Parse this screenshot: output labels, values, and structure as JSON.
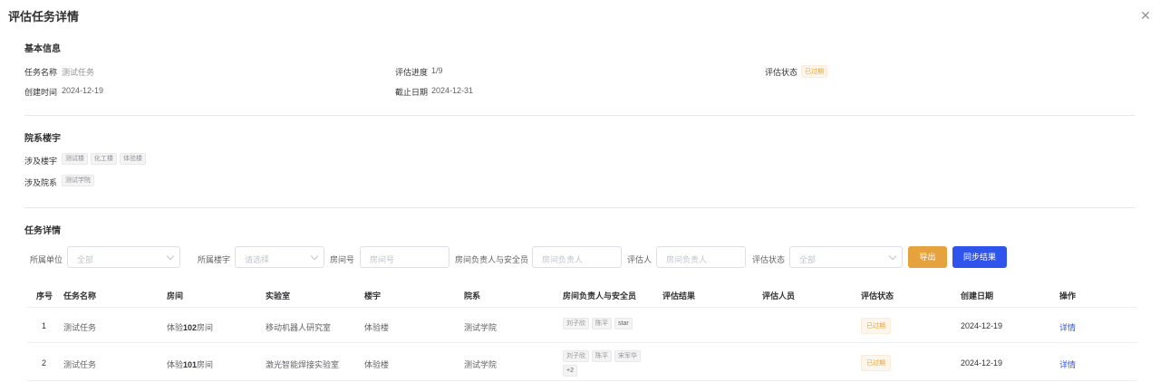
{
  "dialog": {
    "title": "评估任务详情"
  },
  "basic": {
    "section_title": "基本信息",
    "task_name_label": "任务名称",
    "task_name": "测试任务",
    "progress_label": "评估进度",
    "progress": "1/9",
    "status_label": "评估状态",
    "status": "已过期",
    "created_label": "创建时间",
    "created": "2024-12-19",
    "deadline_label": "截止日期",
    "deadline": "2024-12-31"
  },
  "buildings": {
    "section_title": "院系楼宇",
    "buildings_label": "涉及楼宇",
    "buildings": [
      "测试楼",
      "化工楼",
      "体验楼"
    ],
    "departments_label": "涉及院系",
    "departments": [
      "测试学院"
    ]
  },
  "details": {
    "section_title": "任务详情",
    "filters": {
      "unit_label": "所属单位",
      "unit_placeholder": "全部",
      "building_label": "所属楼宇",
      "building_placeholder": "请选择",
      "room_label": "房间号",
      "room_placeholder": "房间号",
      "owner_label": "房间负责人与安全员",
      "owner_placeholder": "房间负责人",
      "evaluator_label": "评估人",
      "evaluator_placeholder": "房间负责人",
      "status_label": "评估状态",
      "status_placeholder": "全部"
    },
    "export_label": "导出",
    "sync_label": "同步结果",
    "columns": [
      "序号",
      "任务名称",
      "房间",
      "实验室",
      "楼宇",
      "院系",
      "房间负责人与安全员",
      "评估结果",
      "评估人员",
      "评估状态",
      "创建日期",
      "操作"
    ],
    "rows": [
      {
        "index": "1",
        "task": "测试任务",
        "room_prefix": "体验",
        "room_num": "102",
        "room_suffix": "房间",
        "lab": "移动机器人研究室",
        "building": "体验楼",
        "dept": "测试学院",
        "owners": [
          "刘子欣",
          "陈平",
          "star"
        ],
        "result": "",
        "evaluator": "",
        "status": "已过期",
        "date": "2024-12-19",
        "action": "详情"
      },
      {
        "index": "2",
        "task": "测试任务",
        "room_prefix": "体验",
        "room_num": "101",
        "room_suffix": "房间",
        "lab": "激光智能焊接实验室",
        "building": "体验楼",
        "dept": "测试学院",
        "owners": [
          "刘子欣",
          "陈平",
          "宋军华",
          "+2"
        ],
        "result": "",
        "evaluator": "",
        "status": "已过期",
        "date": "2024-12-19",
        "action": "详情"
      }
    ]
  }
}
